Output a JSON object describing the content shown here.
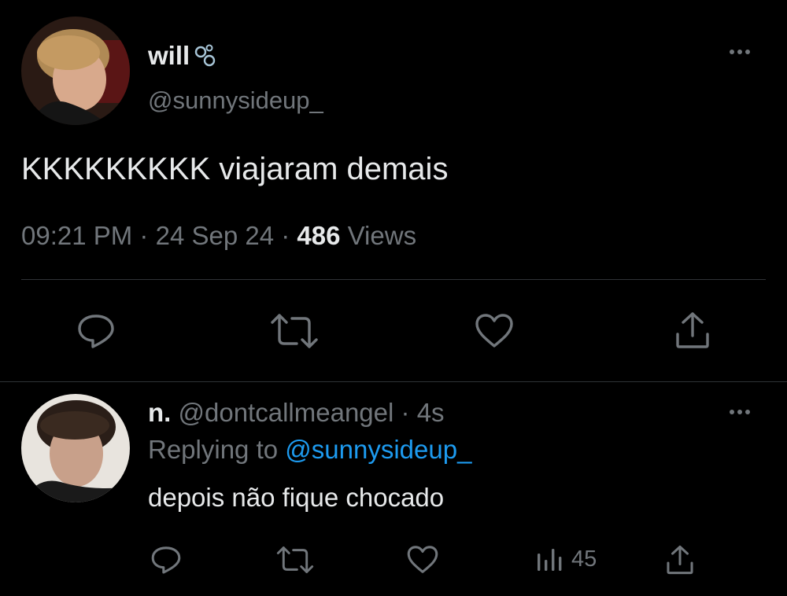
{
  "main_tweet": {
    "display_name": "will",
    "handle": "@sunnysideup_",
    "text": "KKKKKKKKK viajaram demais",
    "time": "09:21 PM",
    "sep1": "·",
    "date": "24 Sep 24",
    "sep2": "·",
    "views_count": "486",
    "views_label": "Views",
    "avatar_icon": "avatar-photo-icon",
    "more_icon": "more-horizontal-icon"
  },
  "actions": [
    "reply-icon",
    "retweet-icon",
    "like-icon",
    "share-icon"
  ],
  "reply_tweet": {
    "display_name": "n.",
    "handle": "@dontcallmeangel",
    "sep": "·",
    "time": "4s",
    "replying_prefix": "Replying to",
    "replying_handle": "@sunnysideup_",
    "text": "depois não fique chocado",
    "views_count": "45"
  },
  "colors": {
    "background": "#000000",
    "text": "#e7e9ea",
    "muted": "#71767b",
    "accent": "#1d9bf0",
    "divider": "#2f3336"
  }
}
